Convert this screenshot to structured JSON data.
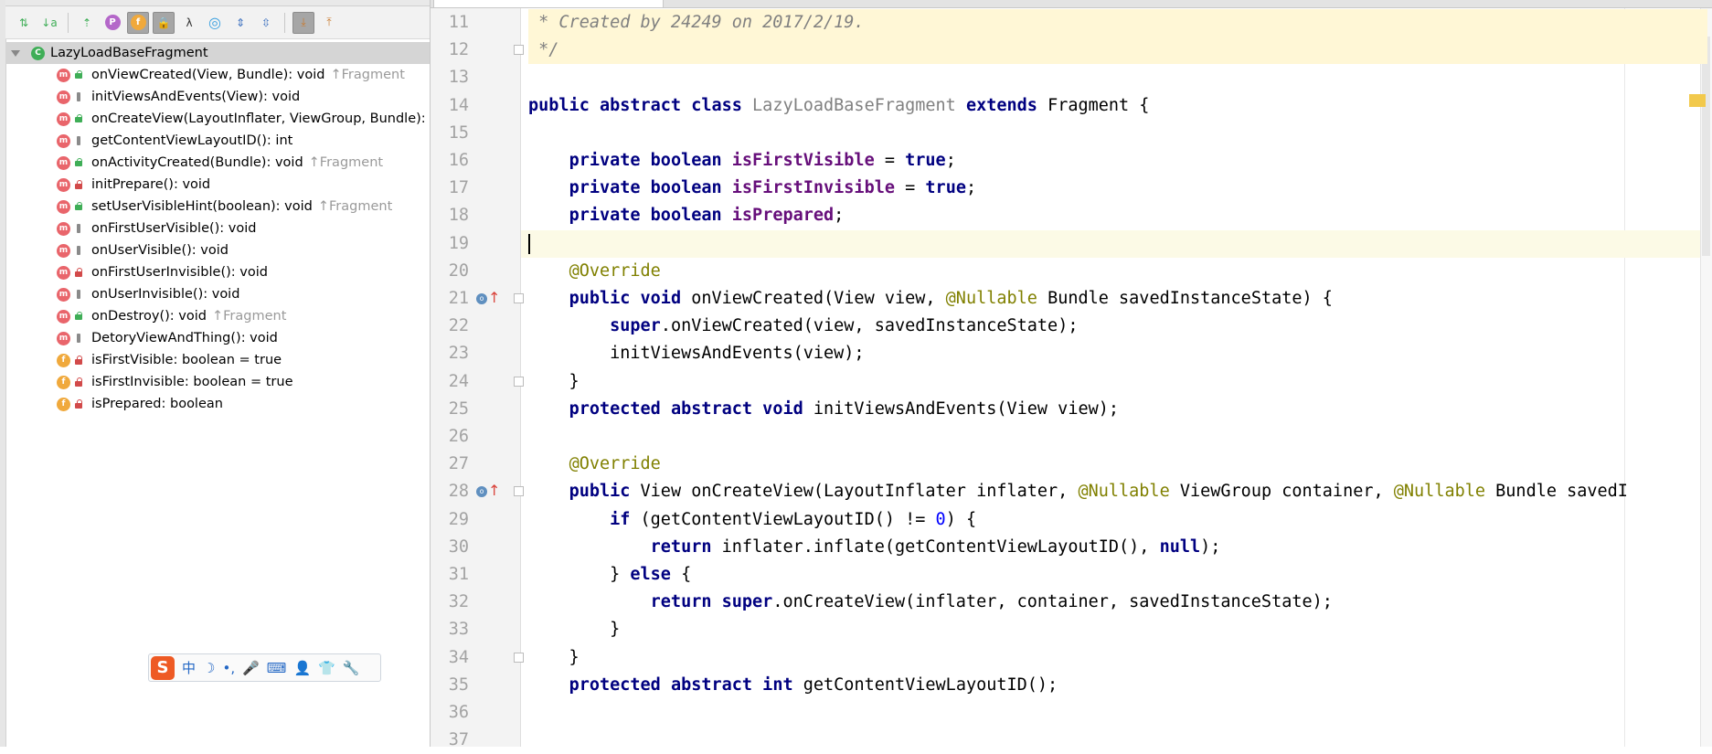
{
  "structure_panel": {
    "root_label": "LazyLoadBaseFragment",
    "items": [
      {
        "kind": "m",
        "visibility": "public",
        "signature": "onViewCreated(View, Bundle): void",
        "super": "↑Fragment"
      },
      {
        "kind": "m",
        "visibility": "protected",
        "signature": "initViewsAndEvents(View): void",
        "super": ""
      },
      {
        "kind": "m",
        "visibility": "public",
        "signature": "onCreateView(LayoutInflater, ViewGroup, Bundle):",
        "super": ""
      },
      {
        "kind": "m",
        "visibility": "protected",
        "signature": "getContentViewLayoutID(): int",
        "super": ""
      },
      {
        "kind": "m",
        "visibility": "public",
        "signature": "onActivityCreated(Bundle): void",
        "super": "↑Fragment"
      },
      {
        "kind": "m",
        "visibility": "private",
        "signature": "initPrepare(): void",
        "super": ""
      },
      {
        "kind": "m",
        "visibility": "public",
        "signature": "setUserVisibleHint(boolean): void",
        "super": "↑Fragment"
      },
      {
        "kind": "m",
        "visibility": "protected",
        "signature": "onFirstUserVisible(): void",
        "super": ""
      },
      {
        "kind": "m",
        "visibility": "protected",
        "signature": "onUserVisible(): void",
        "super": ""
      },
      {
        "kind": "m",
        "visibility": "private",
        "signature": "onFirstUserInvisible(): void",
        "super": ""
      },
      {
        "kind": "m",
        "visibility": "protected",
        "signature": "onUserInvisible(): void",
        "super": ""
      },
      {
        "kind": "m",
        "visibility": "public",
        "signature": "onDestroy(): void",
        "super": "↑Fragment"
      },
      {
        "kind": "m",
        "visibility": "protected",
        "signature": "DetoryViewAndThing(): void",
        "super": ""
      },
      {
        "kind": "f",
        "visibility": "private",
        "signature": "isFirstVisible: boolean = true",
        "super": ""
      },
      {
        "kind": "f",
        "visibility": "private",
        "signature": "isFirstInvisible: boolean = true",
        "super": ""
      },
      {
        "kind": "f",
        "visibility": "private",
        "signature": "isPrepared: boolean",
        "super": ""
      }
    ]
  },
  "toolbar": {
    "buttons": [
      {
        "icon": "sort-by-visibility-icon",
        "glyph": "⇅"
      },
      {
        "icon": "sort-alphabetically-icon",
        "glyph": "↓a"
      },
      {
        "icon": "show-inherited-icon",
        "glyph": "⇡"
      },
      {
        "icon": "show-properties-icon",
        "glyph": "P"
      },
      {
        "icon": "show-fields-icon",
        "glyph": "f"
      },
      {
        "icon": "show-non-public-icon",
        "glyph": "🔒"
      },
      {
        "icon": "show-lambdas-icon",
        "glyph": "λ"
      },
      {
        "icon": "show-anonymous-icon",
        "glyph": "◎"
      },
      {
        "icon": "expand-all-icon",
        "glyph": "⇕"
      },
      {
        "icon": "collapse-all-icon",
        "glyph": "⇳"
      },
      {
        "icon": "autoscroll-to-source-icon",
        "glyph": "⤓"
      },
      {
        "icon": "autoscroll-from-source-icon",
        "glyph": "⤒"
      }
    ]
  },
  "ime_bar": {
    "logo": "S",
    "items": [
      "中",
      "☽",
      "•,",
      "🎤",
      "⌨",
      "👤",
      "👕",
      "🔧"
    ]
  },
  "editor": {
    "lines": [
      {
        "n": "11",
        "tokens": [
          {
            "t": " * Created by 24249 on 2017/2/19.",
            "c": "cmt"
          }
        ],
        "doc": true
      },
      {
        "n": "12",
        "tokens": [
          {
            "t": " */",
            "c": "cmt"
          }
        ],
        "doc": true,
        "fold": true
      },
      {
        "n": "13",
        "tokens": []
      },
      {
        "n": "14",
        "tokens": [
          {
            "t": "public abstract class ",
            "c": "kw"
          },
          {
            "t": "LazyLoadBaseFragment ",
            "c": "grey"
          },
          {
            "t": "extends ",
            "c": "kw"
          },
          {
            "t": "Fragment {",
            "c": ""
          }
        ]
      },
      {
        "n": "15",
        "tokens": []
      },
      {
        "n": "16",
        "tokens": [
          {
            "t": "    ",
            "c": ""
          },
          {
            "t": "private boolean ",
            "c": "kw"
          },
          {
            "t": "isFirstVisible",
            "c": "fld"
          },
          {
            "t": " = ",
            "c": ""
          },
          {
            "t": "true",
            "c": "kw"
          },
          {
            "t": ";",
            "c": ""
          }
        ]
      },
      {
        "n": "17",
        "tokens": [
          {
            "t": "    ",
            "c": ""
          },
          {
            "t": "private boolean ",
            "c": "kw"
          },
          {
            "t": "isFirstInvisible",
            "c": "fld"
          },
          {
            "t": " = ",
            "c": ""
          },
          {
            "t": "true",
            "c": "kw"
          },
          {
            "t": ";",
            "c": ""
          }
        ]
      },
      {
        "n": "18",
        "tokens": [
          {
            "t": "    ",
            "c": ""
          },
          {
            "t": "private boolean ",
            "c": "kw"
          },
          {
            "t": "isPrepared",
            "c": "fld"
          },
          {
            "t": ";",
            "c": ""
          }
        ]
      },
      {
        "n": "19",
        "tokens": [],
        "current": true
      },
      {
        "n": "20",
        "tokens": [
          {
            "t": "    ",
            "c": ""
          },
          {
            "t": "@Override",
            "c": "ann"
          }
        ]
      },
      {
        "n": "21",
        "tokens": [
          {
            "t": "    ",
            "c": ""
          },
          {
            "t": "public void ",
            "c": "kw"
          },
          {
            "t": "onViewCreated(View view, ",
            "c": ""
          },
          {
            "t": "@Nullable ",
            "c": "ann"
          },
          {
            "t": "Bundle savedInstanceState) {",
            "c": ""
          }
        ],
        "override": true,
        "fold": true
      },
      {
        "n": "22",
        "tokens": [
          {
            "t": "        ",
            "c": ""
          },
          {
            "t": "super",
            "c": "kw"
          },
          {
            "t": ".onViewCreated(view, savedInstanceState);",
            "c": ""
          }
        ]
      },
      {
        "n": "23",
        "tokens": [
          {
            "t": "        initViewsAndEvents(view);",
            "c": ""
          }
        ]
      },
      {
        "n": "24",
        "tokens": [
          {
            "t": "    }",
            "c": ""
          }
        ],
        "fold": true
      },
      {
        "n": "25",
        "tokens": [
          {
            "t": "    ",
            "c": ""
          },
          {
            "t": "protected abstract void ",
            "c": "kw"
          },
          {
            "t": "initViewsAndEvents(View view);",
            "c": ""
          }
        ]
      },
      {
        "n": "26",
        "tokens": []
      },
      {
        "n": "27",
        "tokens": [
          {
            "t": "    ",
            "c": ""
          },
          {
            "t": "@Override",
            "c": "ann"
          }
        ]
      },
      {
        "n": "28",
        "tokens": [
          {
            "t": "    ",
            "c": ""
          },
          {
            "t": "public ",
            "c": "kw"
          },
          {
            "t": "View onCreateView(LayoutInflater inflater, ",
            "c": ""
          },
          {
            "t": "@Nullable ",
            "c": "ann"
          },
          {
            "t": "ViewGroup container, ",
            "c": ""
          },
          {
            "t": "@Nullable ",
            "c": "ann"
          },
          {
            "t": "Bundle savedI",
            "c": ""
          }
        ],
        "override": true,
        "fold": true
      },
      {
        "n": "29",
        "tokens": [
          {
            "t": "        ",
            "c": ""
          },
          {
            "t": "if ",
            "c": "kw"
          },
          {
            "t": "(getContentViewLayoutID() != ",
            "c": ""
          },
          {
            "t": "0",
            "c": "num"
          },
          {
            "t": ") {",
            "c": ""
          }
        ]
      },
      {
        "n": "30",
        "tokens": [
          {
            "t": "            ",
            "c": ""
          },
          {
            "t": "return ",
            "c": "kw"
          },
          {
            "t": "inflater.inflate(getContentViewLayoutID(), ",
            "c": ""
          },
          {
            "t": "null",
            "c": "kw"
          },
          {
            "t": ");",
            "c": ""
          }
        ]
      },
      {
        "n": "31",
        "tokens": [
          {
            "t": "        } ",
            "c": ""
          },
          {
            "t": "else ",
            "c": "kw"
          },
          {
            "t": "{",
            "c": ""
          }
        ]
      },
      {
        "n": "32",
        "tokens": [
          {
            "t": "            ",
            "c": ""
          },
          {
            "t": "return super",
            "c": "kw"
          },
          {
            "t": ".onCreateView(inflater, container, savedInstanceState);",
            "c": ""
          }
        ]
      },
      {
        "n": "33",
        "tokens": [
          {
            "t": "        }",
            "c": ""
          }
        ]
      },
      {
        "n": "34",
        "tokens": [
          {
            "t": "    }",
            "c": ""
          }
        ],
        "fold": true
      },
      {
        "n": "35",
        "tokens": [
          {
            "t": "    ",
            "c": ""
          },
          {
            "t": "protected abstract int ",
            "c": "kw"
          },
          {
            "t": "getContentViewLayoutID();",
            "c": ""
          }
        ]
      },
      {
        "n": "36",
        "tokens": []
      },
      {
        "n": "37",
        "tokens": []
      }
    ]
  }
}
